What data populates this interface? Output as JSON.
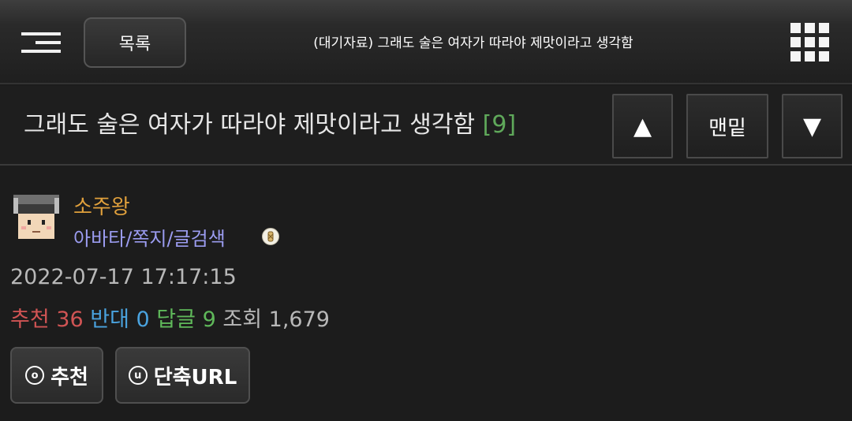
{
  "header": {
    "list_label": "목록",
    "title": "(대기자료) 그래도 술은 여자가 따라야 제맛이라고 생각함"
  },
  "post": {
    "title": "그래도 술은 여자가 따라야 제맛이라고 생각함",
    "comment_count": "[9]",
    "nav_up": "▲",
    "nav_bottom": "맨밑",
    "nav_down": "▼"
  },
  "author": {
    "name": "소주왕",
    "links": "아바타/쪽지/글검색"
  },
  "meta": {
    "datetime": "2022-07-17 17:17:15",
    "recommend_label": "추천",
    "recommend_count": "36",
    "oppose_label": "반대",
    "oppose_count": "0",
    "reply_label": "답글",
    "reply_count": "9",
    "view_label": "조회",
    "view_count": "1,679"
  },
  "actions": {
    "recommend_icon": "o",
    "recommend_label": "추천",
    "shorturl_icon": "u",
    "shorturl_label": "단축URL"
  },
  "icons": {
    "menu": "menu-icon",
    "apps": "grid-icon",
    "badge": "badge-icon"
  },
  "colors": {
    "author": "#e0a03c",
    "links": "#9b9cf0",
    "recommend": "#d05454",
    "oppose": "#4aa3df",
    "reply": "#5fb85a",
    "comment_count": "#5fa85a"
  }
}
